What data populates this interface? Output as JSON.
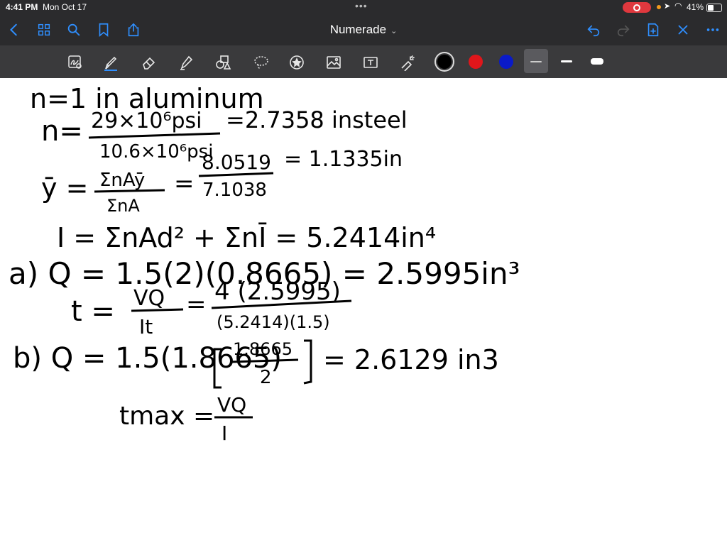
{
  "status_bar": {
    "time": "4:41 PM",
    "date": "Mon Oct 17",
    "battery": "41%"
  },
  "nav": {
    "title": "Numerade",
    "icons": [
      "back-icon",
      "thumbnails-icon",
      "search-icon",
      "bookmark-icon",
      "share-icon",
      "undo-icon",
      "redo-icon",
      "add-page-icon",
      "close-icon",
      "more-icon"
    ]
  },
  "toolbar": {
    "tools": [
      "lasso-read-icon",
      "pen-icon",
      "eraser-icon",
      "highlighter-icon",
      "shapes-icon",
      "lasso-icon",
      "sticker-icon",
      "image-icon",
      "text-icon",
      "laser-icon"
    ],
    "colors": [
      "#000000",
      "#e0161b",
      "#0a1ac8"
    ],
    "selected_color": "#000000",
    "stroke_sizes": [
      "thin",
      "medium",
      "thick"
    ],
    "selected_stroke": "thin"
  },
  "notes": {
    "line1": "n=1 in aluminum",
    "line2_lhs": "n=",
    "line2_num": "29×10⁶psi",
    "line2_den": "10.6×10⁶psi",
    "line2_rhs": "=2.7358 insteel",
    "line3_lhs": "ȳ =",
    "line3_num": "ΣnAȳ",
    "line3_den": "ΣnA",
    "line3_eq": "=",
    "line3_num2": "8.0519",
    "line3_den2": "7.1038",
    "line3_rhs": "= 1.1335in",
    "line4": "I = ΣnAd² + ΣnĪ = 5.2414in⁴",
    "line5": "a) Q = 1.5(2)(0.8665) = 2.5995in³",
    "line6_lhs": "t =",
    "line6_num": "VQ",
    "line6_den": "It",
    "line6_eq": "=",
    "line6_num2": "4 (2.5995)",
    "line6_den2": "(5.2414)(1.5)",
    "line7_lhs": "b) Q = 1.5(1.8665)",
    "line7_num": "1.8665",
    "line7_den": "2",
    "line7_rhs": "= 2.6129 in3",
    "line8_lhs": "tmax =",
    "line8_num": "VQ",
    "line8_den": "I"
  }
}
